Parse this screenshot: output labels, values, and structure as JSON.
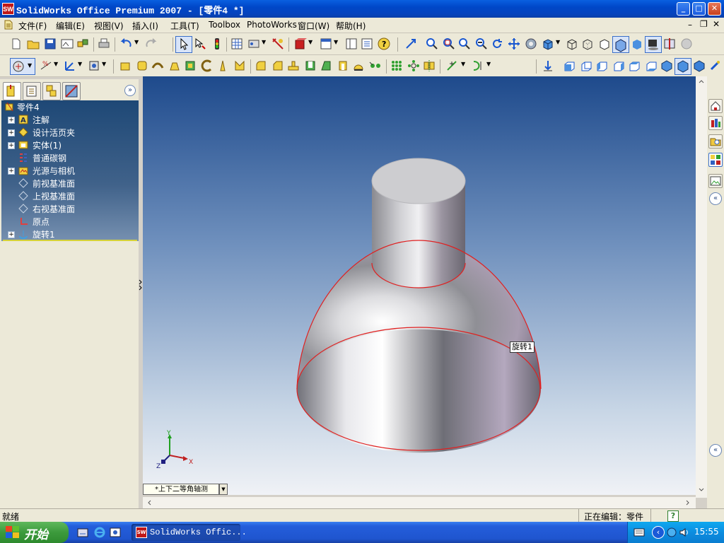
{
  "window": {
    "icon_text": "SW",
    "title": "SolidWorks Office Premium 2007 - [零件4 *]"
  },
  "menu": [
    "文件(F)",
    "编辑(E)",
    "视图(V)",
    "插入(I)",
    "工具(T)",
    "Toolbox",
    "PhotoWorks",
    "窗口(W)",
    "帮助(H)"
  ],
  "feature_tree": {
    "root": "零件4",
    "items": [
      {
        "label": "注解",
        "icon": "annotation-icon",
        "expandable": true
      },
      {
        "label": "设计活页夹",
        "icon": "design-binder-icon",
        "expandable": true
      },
      {
        "label": "实体(1)",
        "icon": "solid-body-icon",
        "expandable": true
      },
      {
        "label": "普通碳钢",
        "icon": "material-icon",
        "expandable": false
      },
      {
        "label": "光源与相机",
        "icon": "lights-camera-icon",
        "expandable": true
      },
      {
        "label": "前视基准面",
        "icon": "plane-icon",
        "expandable": false
      },
      {
        "label": "上视基准面",
        "icon": "plane-icon",
        "expandable": false
      },
      {
        "label": "右视基准面",
        "icon": "plane-icon",
        "expandable": false
      },
      {
        "label": "原点",
        "icon": "origin-icon",
        "expandable": false
      },
      {
        "label": "旋转1",
        "icon": "revolve-icon",
        "expandable": true
      }
    ]
  },
  "viewport": {
    "tooltip": "旋转1",
    "view_selector": "*上下二等角轴测",
    "triad": {
      "x": "X",
      "y": "Y",
      "z": "Z"
    }
  },
  "status": {
    "left": "就绪",
    "editing": "正在编辑：零件",
    "help_icon": "?"
  },
  "taskbar": {
    "start": "开始",
    "task": "SolidWorks Offic...",
    "time": "15:55"
  },
  "colors": {
    "title_bar": "#0054e3",
    "tree_background": "#2a5382",
    "viewport_top": "#1e4a8c",
    "edge_highlight": "#e02020",
    "taskbar": "#245edb",
    "start_button": "#3c9a3c"
  }
}
